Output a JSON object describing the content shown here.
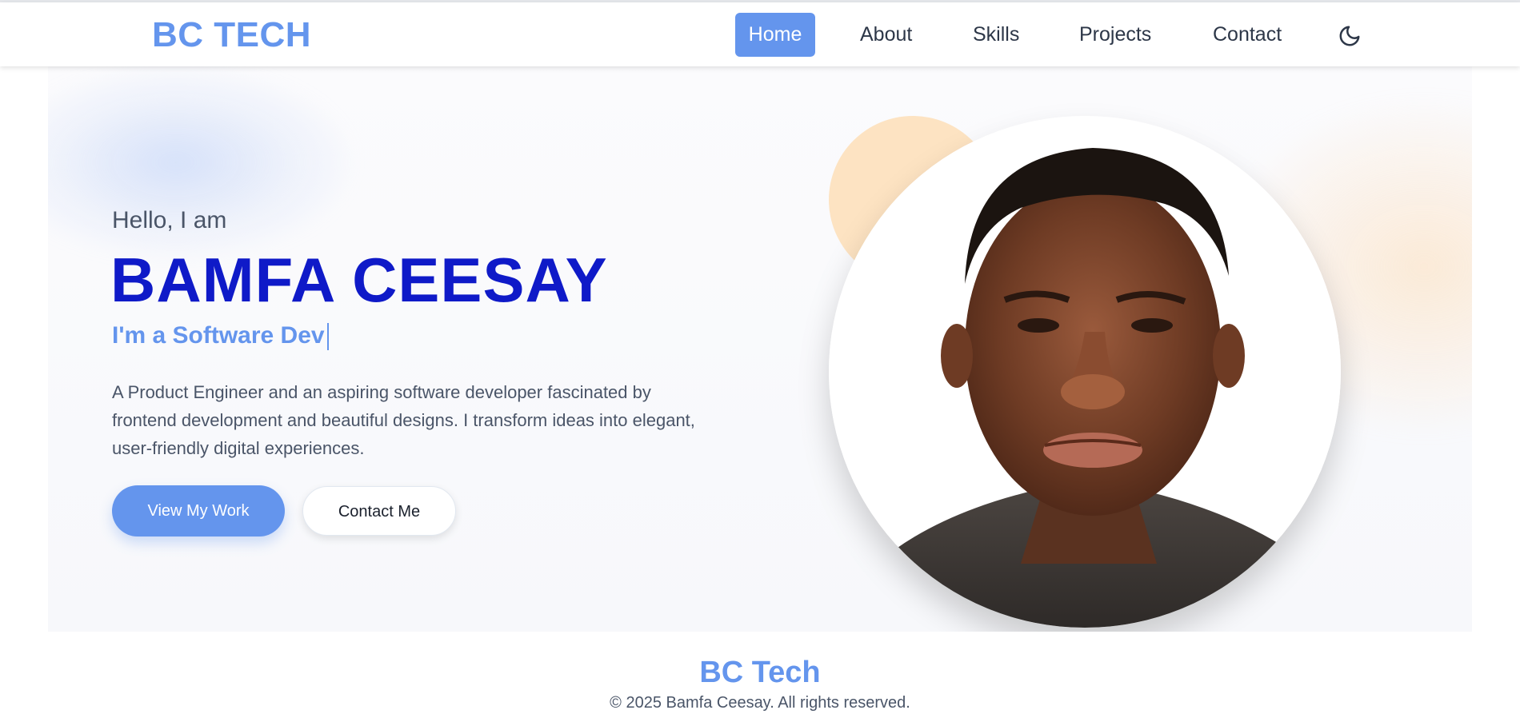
{
  "nav": {
    "brand": "BC TECH",
    "items": [
      {
        "label": "Home",
        "active": true
      },
      {
        "label": "About"
      },
      {
        "label": "Skills"
      },
      {
        "label": "Projects"
      },
      {
        "label": "Contact"
      }
    ],
    "theme_icon": "moon-icon"
  },
  "hero": {
    "greeting": "Hello, I am",
    "name": "BAMFA CEESAY",
    "role": "I'm a Software Dev",
    "bio": "A Product Engineer and an aspiring software developer fascinated by frontend development and beautiful designs. I transform ideas into elegant, user-friendly digital experiences.",
    "primary_button": "View My Work",
    "secondary_button": "Contact Me"
  },
  "footer": {
    "brand": "BC Tech",
    "copyright": "© 2025 Bamfa Ceesay. All rights reserved."
  },
  "colors": {
    "accent": "#6495ed",
    "name": "#0f1ac8",
    "text": "#4a5568"
  }
}
